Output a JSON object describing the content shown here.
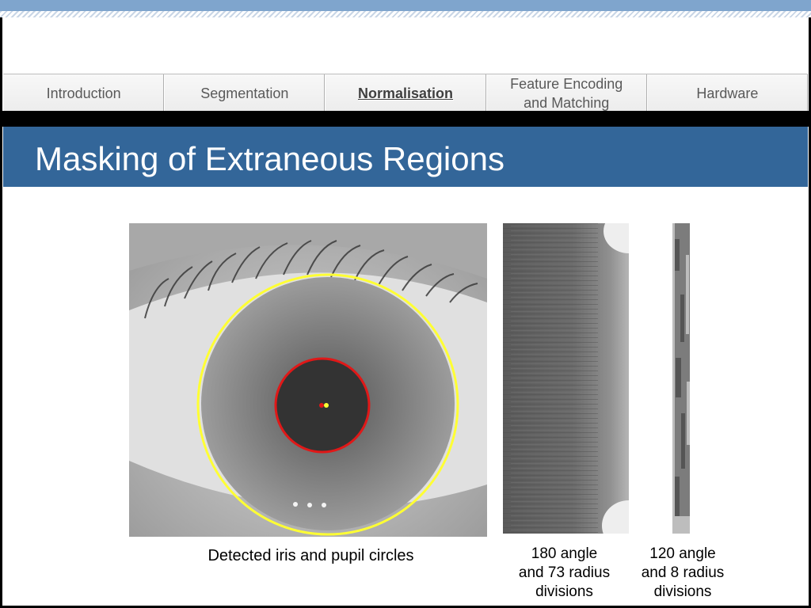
{
  "nav": {
    "tabs": [
      {
        "label": "Introduction",
        "active": false
      },
      {
        "label": "Segmentation",
        "active": false
      },
      {
        "label": "Normalisation",
        "active": true
      },
      {
        "label": "Feature Encoding\nand Matching",
        "active": false
      },
      {
        "label": "Hardware",
        "active": false
      }
    ]
  },
  "slide": {
    "title": "Masking of Extraneous Regions"
  },
  "figures": {
    "eye_caption": "Detected iris and pupil circles",
    "strip1_caption": "180 angle\nand 73 radius\ndivisions",
    "strip2_caption": "120 angle\nand 8 radius\ndivisions",
    "iris_circle_color": "#ffff33",
    "pupil_circle_color": "#e01818"
  },
  "colors": {
    "title_bar": "#336699",
    "top_band": "#7fa5cd"
  }
}
